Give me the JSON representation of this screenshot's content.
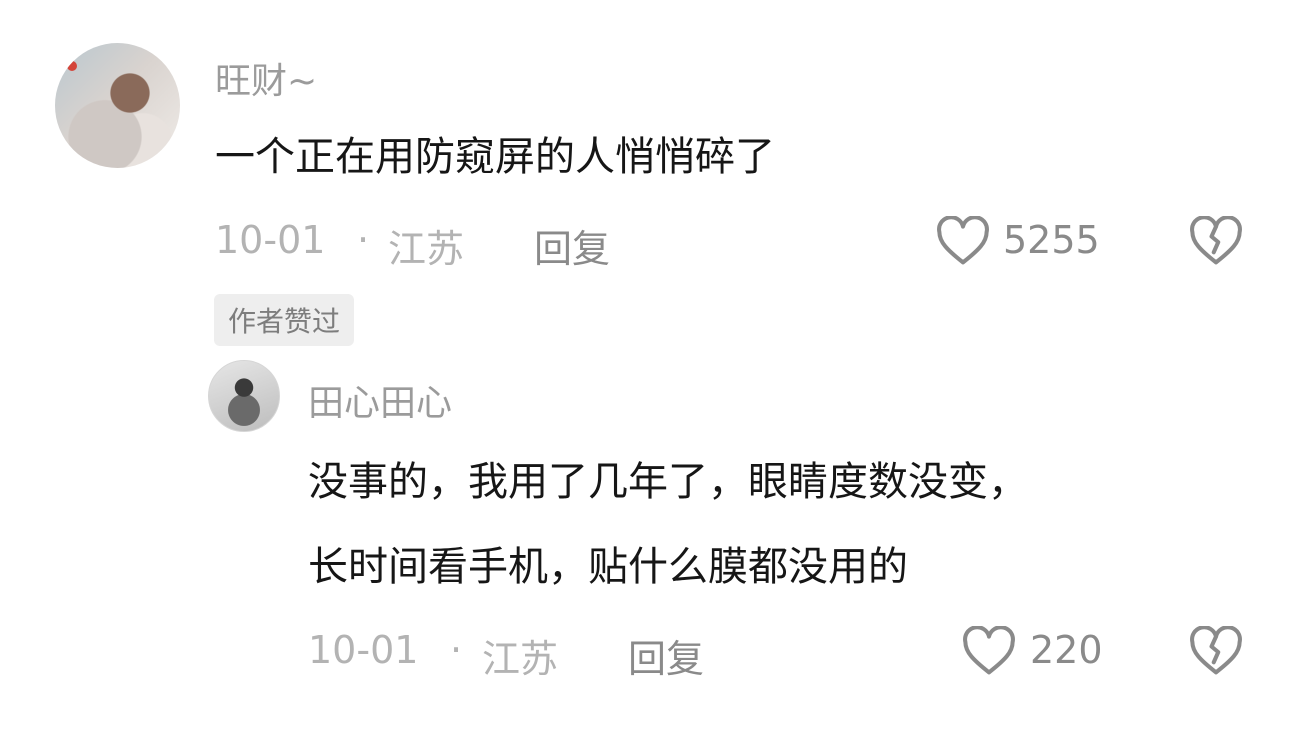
{
  "comments": [
    {
      "username": "旺财~",
      "text": "一个正在用防窥屏的人悄悄碎了",
      "date": "10-01",
      "location": "江苏",
      "separator": "·",
      "reply_label": "回复",
      "likes": "5255",
      "badge": "作者赞过",
      "avatar_icon": "user-avatar",
      "like_icon": "heart-outline-icon",
      "dislike_icon": "broken-heart-icon"
    },
    {
      "username": "田心田心",
      "text_line1": "没事的，我用了几年了，眼睛度数没变，",
      "text_line2": "长时间看手机，贴什么膜都没用的",
      "date": "10-01",
      "location": "江苏",
      "separator": "·",
      "reply_label": "回复",
      "likes": "220",
      "avatar_icon": "user-avatar",
      "like_icon": "heart-outline-icon",
      "dislike_icon": "broken-heart-icon"
    }
  ],
  "colors": {
    "background": "#ffffff",
    "username": "#9b9b9b",
    "text": "#161616",
    "meta": "#b3b3b3",
    "icon": "#8a8a8a",
    "badge_bg": "#eeeeee"
  }
}
